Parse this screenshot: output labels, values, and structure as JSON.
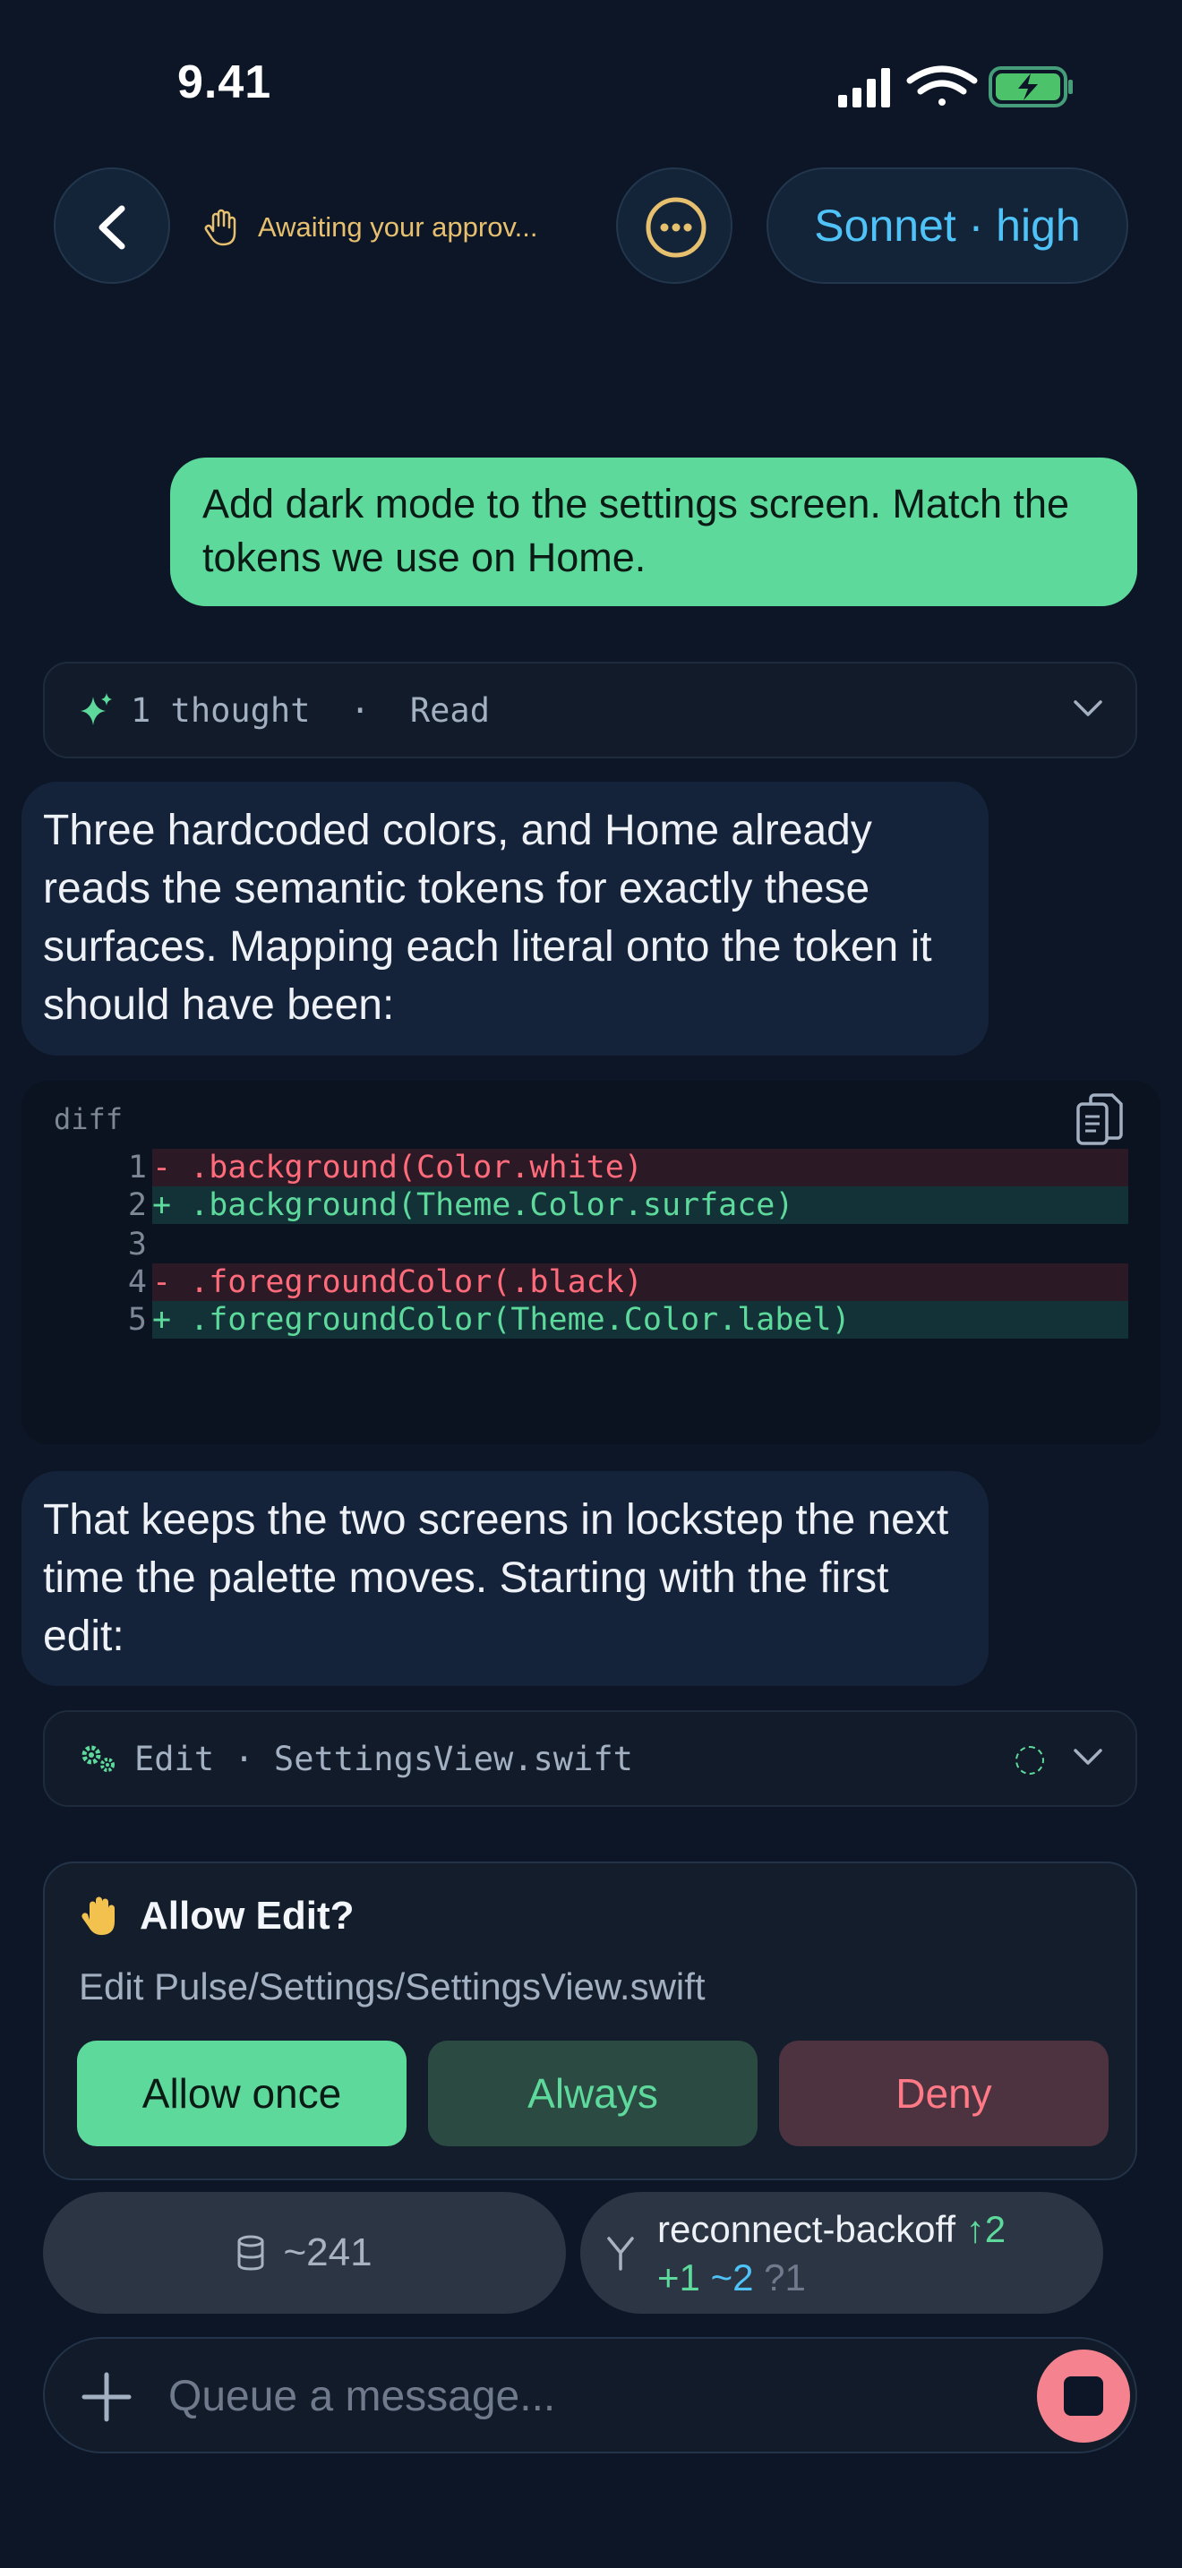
{
  "status_bar": {
    "time": "9.41"
  },
  "header": {
    "status_text": "Awaiting your approv...",
    "model_label": "Sonnet · high"
  },
  "user_message": "Add dark mode to the settings screen. Match the tokens we use on Home.",
  "thought_row": {
    "text": "1 thought  ·  Read"
  },
  "assistant_messages": [
    "Three hardcoded colors, and Home already reads the semantic tokens for exactly these surfaces. Mapping each literal onto the token it should have been:",
    "That keeps the two screens in lockstep the next time the palette moves. Starting with the first edit:"
  ],
  "code_block": {
    "language": "diff",
    "lines": [
      {
        "num": "1",
        "text": "- .background(Color.white)",
        "kind": "del"
      },
      {
        "num": "2",
        "text": "+ .background(Theme.Color.surface)",
        "kind": "add"
      },
      {
        "num": "3",
        "text": "",
        "kind": "plain"
      },
      {
        "num": "4",
        "text": "- .foregroundColor(.black)",
        "kind": "del"
      },
      {
        "num": "5",
        "text": "+ .foregroundColor(Theme.Color.label)",
        "kind": "add"
      }
    ]
  },
  "edit_row": {
    "text": "Edit · SettingsView.swift"
  },
  "approval": {
    "title": "Allow Edit?",
    "subtitle": "Edit Pulse/Settings/SettingsView.swift",
    "allow_once": "Allow once",
    "always": "Always",
    "deny": "Deny"
  },
  "chips": {
    "context": "~241",
    "branch_name": "reconnect-backoff",
    "ahead": "↑2",
    "added": "+1",
    "modified": "~2",
    "untracked": "?1"
  },
  "composer": {
    "placeholder": "Queue a message..."
  },
  "colors": {
    "background": "#0c1626",
    "accent_green": "#5ed99c",
    "accent_blue": "#4fc3f7",
    "warning": "#e6c06f",
    "danger": "#ff7a86"
  }
}
